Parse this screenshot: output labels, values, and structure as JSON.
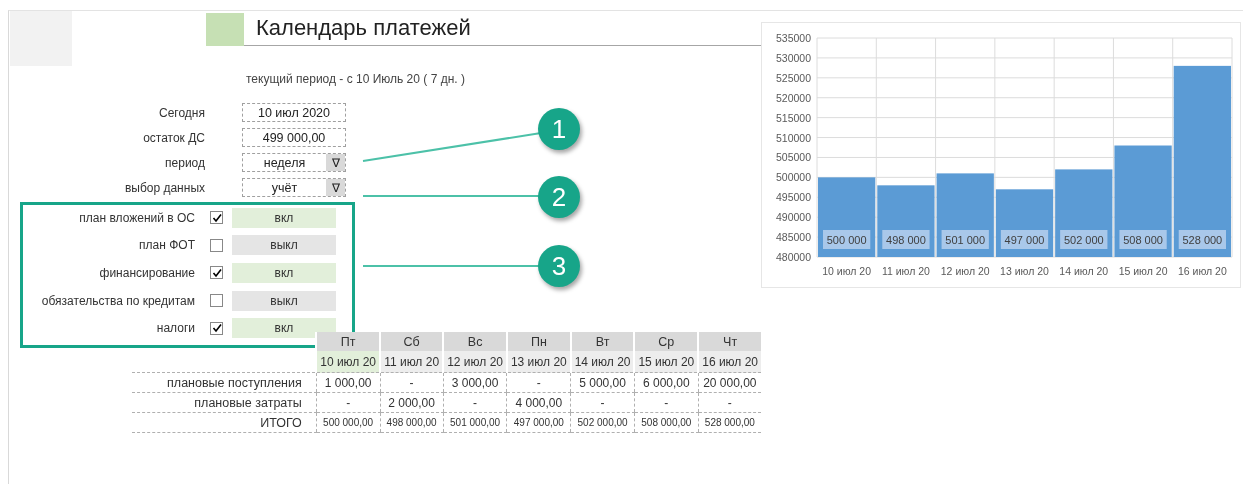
{
  "title": "Календарь платежей",
  "period_caption": "текущий период - с 10 Июль 20 ( 7 дн. )",
  "fields": [
    {
      "label": "Сегодня",
      "value": "10 июл 2020",
      "kind": "text"
    },
    {
      "label": "остаток ДС",
      "value": "499 000,00",
      "kind": "text"
    },
    {
      "label": "период",
      "value": "неделя",
      "kind": "dropdown",
      "button": "∇"
    },
    {
      "label": "выбор данных",
      "value": "учёт",
      "kind": "dropdown",
      "button": "∇"
    }
  ],
  "toggles": [
    {
      "label": "план вложений в ОС",
      "checked": true,
      "state": "вкл"
    },
    {
      "label": "план ФОТ",
      "checked": false,
      "state": "выкл"
    },
    {
      "label": "финансирование",
      "checked": true,
      "state": "вкл"
    },
    {
      "label": "обязательства по кредитам",
      "checked": false,
      "state": "выкл"
    },
    {
      "label": "налоги",
      "checked": true,
      "state": "вкл"
    }
  ],
  "callouts": [
    {
      "number": "1"
    },
    {
      "number": "2"
    },
    {
      "number": "3"
    }
  ],
  "table": {
    "days": [
      {
        "weekday": "Пт",
        "date": "10 июл 20",
        "selected": true
      },
      {
        "weekday": "Сб",
        "date": "11 июл 20",
        "selected": false
      },
      {
        "weekday": "Вс",
        "date": "12 июл 20",
        "selected": false
      },
      {
        "weekday": "Пн",
        "date": "13 июл 20",
        "selected": false
      },
      {
        "weekday": "Вт",
        "date": "14 июл 20",
        "selected": false
      },
      {
        "weekday": "Ср",
        "date": "15 июл 20",
        "selected": false
      },
      {
        "weekday": "Чт",
        "date": "16 июл 20",
        "selected": false
      }
    ],
    "rows": [
      {
        "label": "плановые поступления",
        "kind": "data",
        "cells": [
          "1 000,00",
          "-",
          "3 000,00",
          "-",
          "5 000,00",
          "6 000,00",
          "20 000,00"
        ]
      },
      {
        "label": "плановые затраты",
        "kind": "data",
        "cells": [
          "-",
          "2 000,00",
          "-",
          "4 000,00",
          "-",
          "-",
          "-"
        ]
      },
      {
        "label": "ИТОГО",
        "kind": "total",
        "cells": [
          "500 000,00",
          "498 000,00",
          "501 000,00",
          "497 000,00",
          "502 000,00",
          "508 000,00",
          "528 000,00"
        ]
      }
    ]
  },
  "chart": {
    "chart_data": {
      "type": "bar",
      "categories": [
        "10 июл 20",
        "11 июл 20",
        "12 июл 20",
        "13 июл 20",
        "14 июл 20",
        "15 июл 20",
        "16 июл 20"
      ],
      "grid": true,
      "series": [
        {
          "color": "#5b9bd5",
          "values": [
            500000,
            498000,
            501000,
            497000,
            502000,
            508000,
            528000
          ]
        }
      ],
      "ylim": [
        480000,
        535000
      ],
      "yticks": [
        480000,
        485000,
        490000,
        495000,
        500000,
        505000,
        510000,
        515000,
        520000,
        525000,
        530000,
        535000
      ],
      "value_labels": [
        "500 000",
        "498 000",
        "501 000",
        "497 000",
        "502 000",
        "508 000",
        "528 000"
      ]
    }
  }
}
